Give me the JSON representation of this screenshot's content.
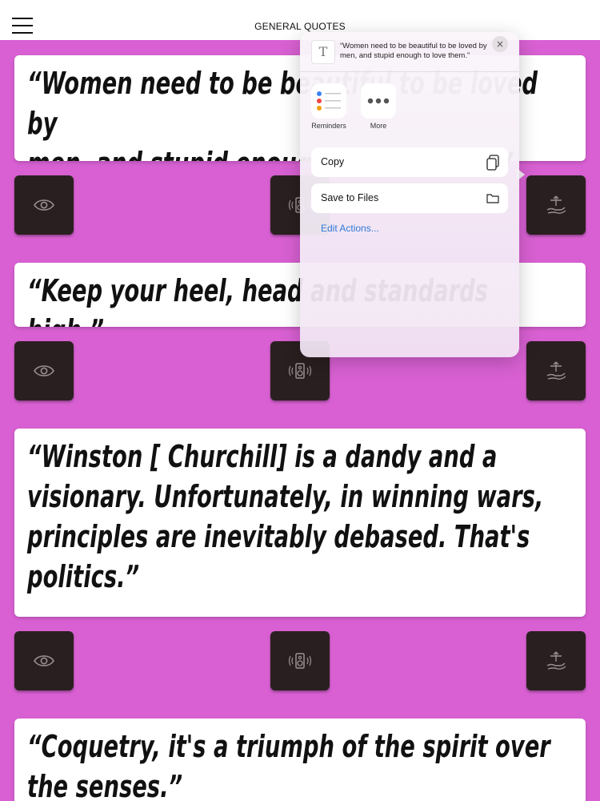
{
  "header": {
    "title": "GENERAL QUOTES"
  },
  "quotes": [
    {
      "text": "“Women need to be beautiful to be loved by\nmen, and stupid enough to love them.”"
    },
    {
      "text": "“Keep your heel, head and standards high.”"
    },
    {
      "text": "“Winston [ Churchill] is a dandy and a\nvisionary. Unfortunately, in winning wars,\nprinciples are inevitably debased. That's\npolitics.”"
    },
    {
      "text": "“Coquetry, it's a triumph of the spirit over\nthe senses.”"
    }
  ],
  "share_sheet": {
    "preview_text": "“Women need to be beautiful to be loved by men, and stupid enough to love them.”",
    "close_symbol": "×",
    "apps": [
      {
        "label": "Reminders",
        "icon": "reminders-icon"
      },
      {
        "label": "More",
        "icon": "more-icon"
      }
    ],
    "actions": [
      {
        "label": "Copy",
        "icon": "copy-icon"
      },
      {
        "label": "Save to Files",
        "icon": "folder-icon"
      }
    ],
    "edit_actions_label": "Edit Actions..."
  },
  "colors": {
    "background": "#d860d2",
    "tile": "#2a1f20",
    "link": "#2f7ad6"
  }
}
